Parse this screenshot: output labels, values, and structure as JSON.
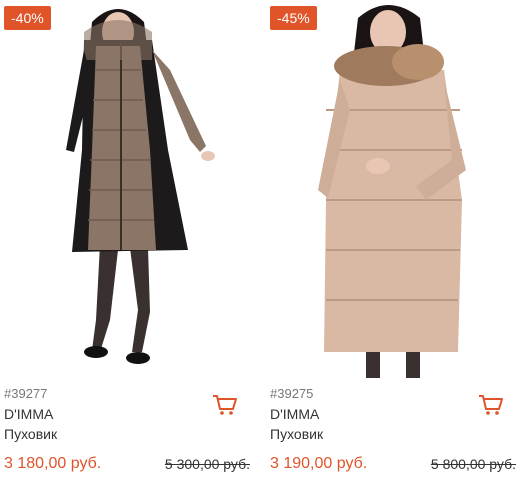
{
  "products": [
    {
      "discount": "-40%",
      "sku": "#39277",
      "brand": "D'IMMA",
      "type": "Пуховик",
      "price": "3 180,00 руб.",
      "old_price": "5 300,00 руб.",
      "icon": "shopping-cart-icon"
    },
    {
      "discount": "-45%",
      "sku": "#39275",
      "brand": "D'IMMA",
      "type": "Пуховик",
      "price": "3 190,00 руб.",
      "old_price": "5 800,00 руб.",
      "icon": "shopping-cart-icon"
    }
  ],
  "colors": {
    "accent": "#e0542a",
    "text": "#333333",
    "muted": "#777777"
  }
}
